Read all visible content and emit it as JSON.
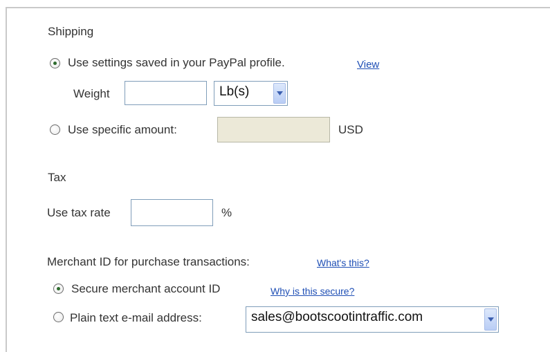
{
  "shipping": {
    "heading": "Shipping",
    "option_profile_label": "Use settings saved in your PayPal profile.",
    "option_profile_link": "View",
    "weight_label": "Weight",
    "weight_value": "",
    "weight_unit": "Lb(s)",
    "option_specific_label": "Use specific amount:",
    "specific_amount_value": "",
    "currency": "USD"
  },
  "tax": {
    "heading": "Tax",
    "rate_label": "Use tax rate",
    "rate_value": "",
    "rate_unit": "%"
  },
  "merchant": {
    "heading": "Merchant ID for purchase transactions:",
    "help_link": "What's this?",
    "option_secure_label": "Secure merchant account ID",
    "option_secure_link": "Why is this secure?",
    "option_email_label": "Plain text e-mail address:",
    "email_value": "sales@bootscootintraffic.com"
  },
  "colors": {
    "link": "#1f4fb5",
    "radio_dot": "#2e6b2e",
    "disabled_field": "#ece9d8",
    "input_border": "#7f9db9"
  }
}
